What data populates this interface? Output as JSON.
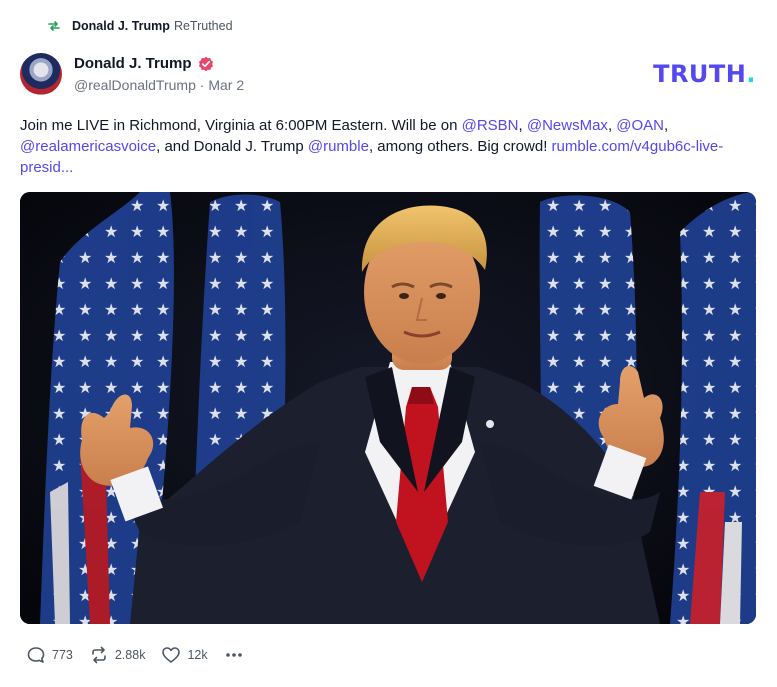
{
  "retruth": {
    "retruther": "Donald J. Trump",
    "label": "ReTruthed"
  },
  "post": {
    "author_name": "Donald J. Trump",
    "handle": "@realDonaldTrump",
    "separator": "·",
    "date": "Mar 2",
    "text_parts": [
      {
        "text": "Join me LIVE in Richmond, Virginia at 6:00PM Eastern. Will be on ",
        "link": false
      },
      {
        "text": "@RSBN",
        "link": true
      },
      {
        "text": ", ",
        "link": false
      },
      {
        "text": "@NewsMax",
        "link": true
      },
      {
        "text": ", ",
        "link": false
      },
      {
        "text": "@OAN",
        "link": true
      },
      {
        "text": ", ",
        "link": false
      },
      {
        "text": "@realamericasvoice",
        "link": true
      },
      {
        "text": ", and Donald J. Trump ",
        "link": false
      },
      {
        "text": "@rumble",
        "link": true
      },
      {
        "text": ", among others. Big crowd! ",
        "link": false
      },
      {
        "text": "rumble.com/v4gub6c-live-presid...",
        "link": true
      }
    ],
    "image_icon": "photo-of-speaker-thumbs-up-with-flags"
  },
  "brand": {
    "logo_text": "TRUTH",
    "logo_dot": ".",
    "accent": "#5448ee",
    "dot_color": "#17e2c7"
  },
  "actions": {
    "replies": "773",
    "retruths": "2.88k",
    "likes": "12k",
    "reply_icon": "speech-bubble-icon",
    "retruth_icon": "retruth-arrows-icon",
    "like_icon": "heart-icon",
    "more_icon": "ellipsis-icon"
  }
}
